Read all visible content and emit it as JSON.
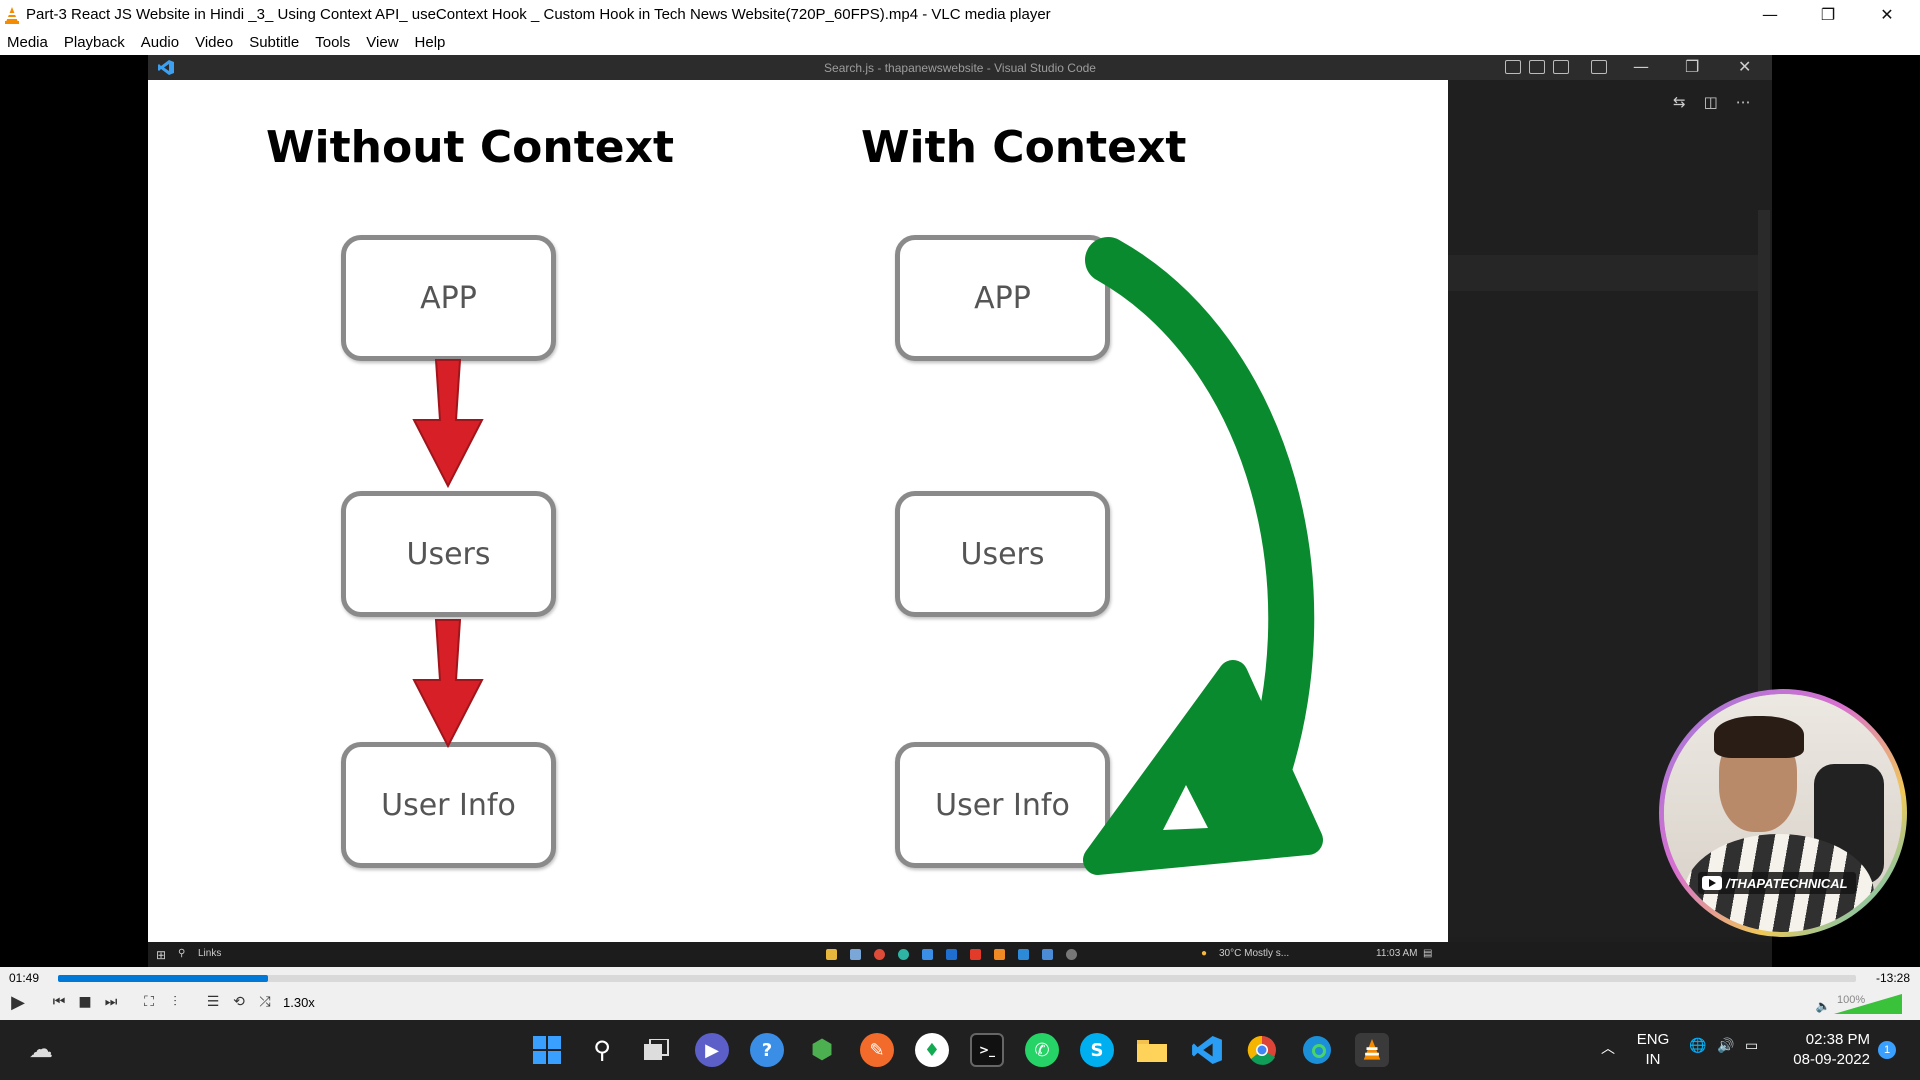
{
  "window": {
    "title": "Part-3  React JS Website in Hindi _3_ Using Context API_ useContext Hook _ Custom Hook in Tech News Website(720P_60FPS).mp4 - VLC media player"
  },
  "menu": {
    "items": [
      "Media",
      "Playback",
      "Audio",
      "Video",
      "Subtitle",
      "Tools",
      "View",
      "Help"
    ]
  },
  "video": {
    "vscode_title": "Search.js - thapanewswebsite - Visual Studio Code",
    "slide": {
      "left_heading": "Without Context",
      "right_heading": "With Context",
      "left_boxes": [
        "APP",
        "Users",
        "User Info"
      ],
      "right_boxes": [
        "APP",
        "Users",
        "User Info"
      ],
      "arrow_colors": {
        "without": "#d61f26",
        "with": "#0a8a2e"
      }
    },
    "webcam": {
      "channel_tag": "/THAPATECHNICAL"
    },
    "inner_taskbar": {
      "search_label": "Links",
      "weather": "30°C  Mostly s...",
      "clock": "11:03 AM"
    }
  },
  "player": {
    "elapsed": "01:49",
    "remaining": "-13:28",
    "progress_fraction": 0.117,
    "speed": "1.30x",
    "volume": "100%"
  },
  "taskbar": {
    "language": "ENG",
    "region": "IN",
    "time": "02:38 PM",
    "date": "08-09-2022",
    "notification_count": "1"
  }
}
